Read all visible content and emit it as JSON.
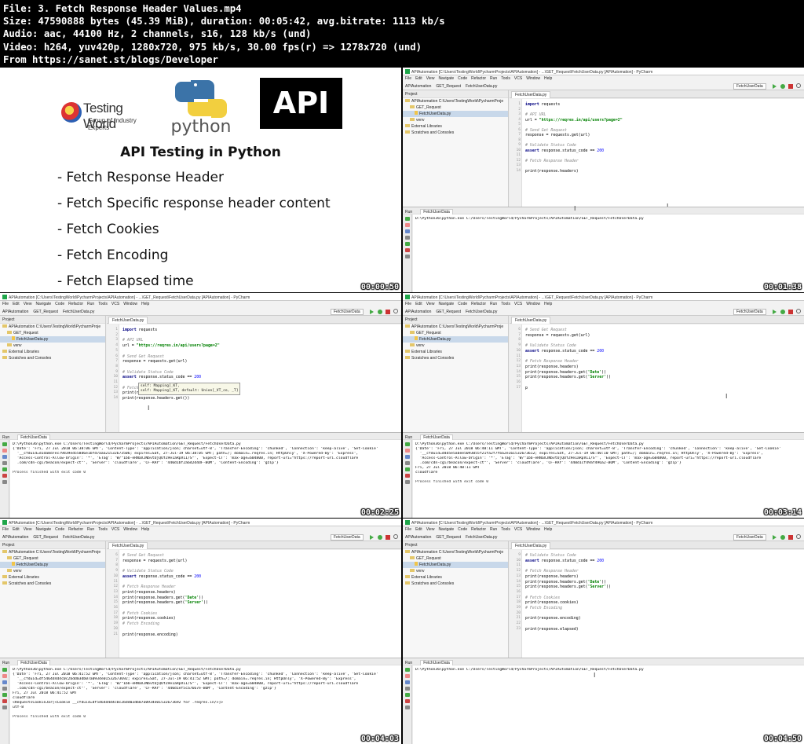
{
  "header": {
    "line1": "File: 3. Fetch Response Header Values.mp4",
    "line2": "Size: 47590888 bytes (45.39 MiB), duration: 00:05:42, avg.bitrate: 1113 kb/s",
    "line3": "Audio: aac, 44100 Hz, 2 channels, s16, 128 kb/s (und)",
    "line4": "Video: h264, yuv420p, 1280x720, 975 kb/s, 30.00 fps(r) => 1278x720 (und)",
    "line5": "From https://sanet.st/blogs/Developer"
  },
  "slide": {
    "logo_tw": "Testing World",
    "logo_tw_sub": "Group of Industry Experts",
    "logo_py": "python",
    "logo_api": "API",
    "title": "API Testing in Python",
    "bullets": [
      "- Fetch Response Header",
      "- Fetch Specific response header content",
      "- Fetch Cookies",
      "- Fetch Encoding",
      "- Fetch Elapsed time"
    ],
    "timestamp": "00:00:50"
  },
  "ide_common": {
    "title": "APIAutomation [C:\\Users\\TestingWorld\\PycharmProjects\\APIAutomation] - ...\\GET_Request\\FetchUserData.py [APIAutomation] - PyCharm",
    "title_short": "APIAutomation [C:\\Users\\TestingWorld\\PycharmProjects\\APIAutomation] - ...\\GET_Request\\FetchUserData.py [APIAutomation] - PyCharm",
    "menu": [
      "File",
      "Edit",
      "View",
      "Navigate",
      "Code",
      "Refactor",
      "Run",
      "Tools",
      "VCS",
      "Window",
      "Help"
    ],
    "crumb1": "APIAutomation",
    "crumb2": "GET_Request",
    "crumb3": "FetchUserData.py",
    "run_config": "FetchUserData",
    "project_label": "Project",
    "tree": [
      "APIAutomation  C:\\Users\\TestingWorld\\PycharmProje",
      "GET_Request",
      "FetchUserData.py",
      "venv",
      "External Libraries",
      "Scratches and Consoles"
    ],
    "tab": "FetchUserData.py",
    "run_label": "Run",
    "run_tab": "FetchUserData",
    "cmd": "D:\\Python36\\python.exe C:/Users/TestingWorld/PycharmProjects/APIAutomation/GET_Request/FetchUserData.py",
    "cmd_short": "D:\\Python36\\python.exe C:/Users/TestingWorld/PycharmProjects/APIAutomation/GET_Request/FetchUserData.py",
    "exit": "Process finished with exit code 0"
  },
  "panel2": {
    "timestamp": "00:01:38",
    "code": [
      [
        "1",
        "import requests"
      ],
      [
        "2",
        ""
      ],
      [
        "3",
        "# API URL"
      ],
      [
        "4",
        "url = \"https://reqres.in/api/users?page=2\""
      ],
      [
        "5",
        ""
      ],
      [
        "6",
        "# Send Get Request"
      ],
      [
        "7",
        "response = requests.get(url)"
      ],
      [
        "8",
        ""
      ],
      [
        "9",
        "# Validate Status Code"
      ],
      [
        "10",
        "assert response.status_code == 200"
      ],
      [
        "11",
        ""
      ],
      [
        "12",
        "# Fetch Response Header"
      ],
      [
        "13",
        ""
      ],
      [
        "14",
        "print(response.headers)"
      ]
    ]
  },
  "panel3": {
    "timestamp": "00:02:25",
    "code": [
      [
        "1",
        "import requests"
      ],
      [
        "2",
        ""
      ],
      [
        "3",
        "# API URL"
      ],
      [
        "4",
        "url = \"https://reqres.in/api/users?page=2\""
      ],
      [
        "5",
        ""
      ],
      [
        "6",
        "# Send Get Request"
      ],
      [
        "7",
        "response = requests.get(url)"
      ],
      [
        "8",
        ""
      ],
      [
        "9",
        "# Validate Status Code"
      ],
      [
        "10",
        "assert response.status_code == 200"
      ],
      [
        "11",
        ""
      ],
      [
        "12",
        "# Fetch R"
      ],
      [
        "13",
        "print(response.headers)"
      ],
      [
        "14",
        "print(response.headers.get())"
      ]
    ],
    "tooltip": "self: Mapping[_KT,\nself: Mapping[_KT, default: Union[_VT_co, _T]",
    "out": [
      "{'Date': 'Fri, 27 Jul 2018 06:38:06 GMT', 'Content-Type': 'application/json; charset=utf-8', 'Transfer-Encoding': 'chunked', 'Connection': 'keep-alive', 'Set-Cookie'",
      "  '__cfduid=d1da8d7ec79d39ed558d6e1bfd7aaa21532673506; expires=Sat, 27-Jul-19 06:38:05 GMT; path=/; domain=.reqres.in; HttpOnly', 'X-Powered-By': 'Express',",
      "  'Access-Control-Allow-Origin': '*', 'ETag': 'W/\"1bb-eRNaXJNbvtUjQUfZ9e1aRpV1I/S\"', 'Expect-CT': 'max-age=604800, report-uri=\"https://report-uri.cloudflare",
      "  .com/cdn-cgi/beacon/expect-ct\"', 'Server': 'cloudflare', 'CF-RAY': '440d1bf2a6d2d4dF-BOM', 'Content-Encoding': 'gzip'}"
    ]
  },
  "panel4": {
    "timestamp": "00:03:14",
    "code": [
      [
        "6",
        "# Send Get Request"
      ],
      [
        "7",
        "response = requests.get(url)"
      ],
      [
        "8",
        ""
      ],
      [
        "9",
        "# Validate Status Code"
      ],
      [
        "10",
        "assert response.status_code == 200"
      ],
      [
        "11",
        ""
      ],
      [
        "12",
        "# Fetch Response Header"
      ],
      [
        "13",
        "print(response.headers)"
      ],
      [
        "14",
        "print(response.headers.get('Date'))"
      ],
      [
        "15",
        "print(response.headers.get('Server'))"
      ],
      [
        "16",
        ""
      ],
      [
        "17",
        "p"
      ]
    ],
    "out": [
      "{'Date': 'Fri, 27 Jul 2018 06:40:11 GMT', 'Content-Type': 'application/json; charset=utf-8', 'Transfer-Encoding': 'chunked', 'Connection': 'keep-alive', 'Set-Cookie'",
      "  '__cfduid=d4d5e5abee5093055f21fa2f7fba2e161532673612; expires=Sat, 27-Jul-19 06:40:10 GMT; path=/; domain=.reqres.in; HttpOnly', 'X-Powered-By': 'Express',",
      "  'Access-Control-Allow-Origin': '*', 'ETag': 'W/\"1bb-eRNaXJNbvtUjQUfZ9e1aRpV1I/S\"', 'Expect-CT': 'max-age=604800, report-uri=\"https://report-uri.cloudflare",
      "  .com/cdn-cgi/beacon/expect-ct\"', 'Server': 'cloudflare', 'CF-RAY': '440d1cf49af496a2-BOM', 'Content-Encoding': 'gzip'}",
      "Fri, 27 Jul 2018 06:40:11 GMT",
      "cloudflare"
    ]
  },
  "panel5": {
    "timestamp": "00:04:03",
    "code": [
      [
        "6",
        "# Send Get Request"
      ],
      [
        "7",
        "response = requests.get(url)"
      ],
      [
        "8",
        ""
      ],
      [
        "9",
        "# Validate Status Code"
      ],
      [
        "10",
        "assert response.status_code == 200"
      ],
      [
        "11",
        ""
      ],
      [
        "12",
        "# Fetch Response Header"
      ],
      [
        "13",
        "print(response.headers)"
      ],
      [
        "14",
        "print(response.headers.get('Date'))"
      ],
      [
        "15",
        "print(response.headers.get('Server'))"
      ],
      [
        "16",
        ""
      ],
      [
        "17",
        "# Fetch Cookies"
      ],
      [
        "18",
        "print(response.cookies)"
      ],
      [
        "19",
        "# Fetch Encoding"
      ],
      [
        "20",
        ""
      ],
      [
        "21",
        "print(response.encoding)"
      ]
    ],
    "out": [
      "{'Date': 'Fri, 27 Jul 2018 06:41:52 GMT', 'Content-Type': 'application/json; charset=utf-8', 'Transfer-Encoding': 'chunked', 'Connection': 'keep-alive', 'Set-Cookie'",
      "  '__cfduid=df5464d4d4c0c2bdd03db07a0934e01532673692; expires=Sat, 27-Jul-19 06:41:52 GMT; path=/; domain=.reqres.in; HttpOnly', 'X-Powered-By': 'Express',",
      "  'Access-Control-Allow-Origin': '*', 'ETag': 'W/\"1bb-eRNaXJNbvtUjQUfZ9e1aRpV1I/S\"', 'Expect-CT': 'max-age=604800, report-uri=\"https://report-uri.cloudflare",
      "  .com/cdn-cgi/beacon/expect-ct\"', 'Server': 'cloudflare', 'CF-RAY': '440d1ef5ca7667e-BOM', 'Content-Encoding': 'gzip'}",
      "Fri, 27 Jul 2018 06:41:52 GMT",
      "cloudflare",
      "<RequestsCookieJar[<Cookie __cfduid=df5464d4d4c0c2bdd03db07a0934e01532673692 for .reqres.in/>]>",
      "utf-8"
    ]
  },
  "panel6": {
    "timestamp": "00:04:50",
    "code": [
      [
        "9",
        "# Validate Status Code"
      ],
      [
        "10",
        "assert response.status_code == 200"
      ],
      [
        "11",
        ""
      ],
      [
        "12",
        "# Fetch Response Header"
      ],
      [
        "13",
        "print(response.headers)"
      ],
      [
        "14",
        "print(response.headers.get('Date'))"
      ],
      [
        "15",
        "print(response.headers.get('Server'))"
      ],
      [
        "16",
        ""
      ],
      [
        "17",
        "# Fetch Cookies"
      ],
      [
        "18",
        "print(response.cookies)"
      ],
      [
        "19",
        "# Fetch Encoding"
      ],
      [
        "20",
        ""
      ],
      [
        "21",
        "print(response.encoding)"
      ],
      [
        "22",
        ""
      ],
      [
        "23",
        "print(response.elapsed)"
      ]
    ]
  }
}
